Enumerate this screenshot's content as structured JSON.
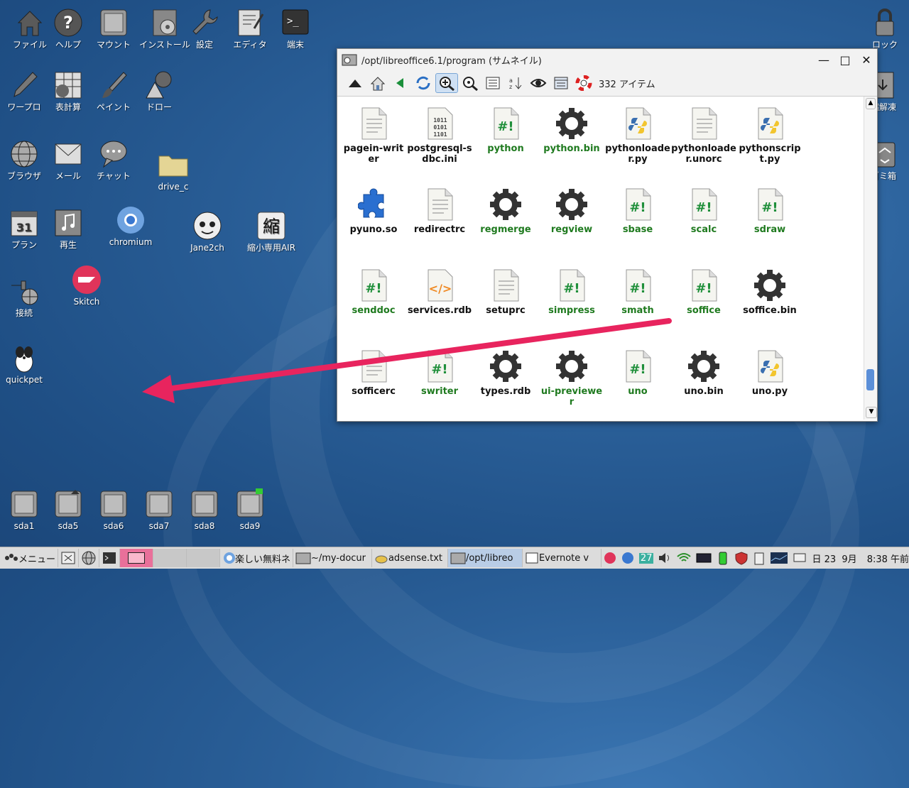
{
  "desktop": {
    "icons": [
      {
        "label": "ファイル"
      },
      {
        "label": "ヘルプ"
      },
      {
        "label": "マウント"
      },
      {
        "label": "インストール"
      },
      {
        "label": "設定"
      },
      {
        "label": "エディタ"
      },
      {
        "label": "端末"
      },
      {
        "label": "ワープロ"
      },
      {
        "label": "表計算"
      },
      {
        "label": "ペイント"
      },
      {
        "label": "ドロー"
      },
      {
        "label": "ブラウザ"
      },
      {
        "label": "メール"
      },
      {
        "label": "チャット"
      },
      {
        "label": "drive_c"
      },
      {
        "label": "プラン"
      },
      {
        "label": "再生"
      },
      {
        "label": "chromium"
      },
      {
        "label": "Jane2ch"
      },
      {
        "label": "縮小専用AIR"
      },
      {
        "label": "接続"
      },
      {
        "label": "Skitch"
      },
      {
        "label": "quickpet"
      },
      {
        "label": "ロック"
      },
      {
        "label": "縮解凍"
      },
      {
        "label": "ゴミ箱"
      }
    ],
    "drives": [
      {
        "label": "sda1"
      },
      {
        "label": "sda5"
      },
      {
        "label": "sda6"
      },
      {
        "label": "sda7"
      },
      {
        "label": "sda8"
      },
      {
        "label": "sda9"
      }
    ]
  },
  "window": {
    "title": "/opt/libreoffice6.1/program (サムネイル)",
    "item_count": "332 アイテム",
    "files": [
      {
        "name": "pagein-writer",
        "type": "text"
      },
      {
        "name": "postgresql-sdbc.ini",
        "type": "binary"
      },
      {
        "name": "python",
        "type": "script"
      },
      {
        "name": "python.bin",
        "type": "exec"
      },
      {
        "name": "pythonloader.py",
        "type": "py"
      },
      {
        "name": "pythonloader.unorc",
        "type": "text"
      },
      {
        "name": "pythonscript.py",
        "type": "py"
      },
      {
        "name": "pyuno.so",
        "type": "plugin"
      },
      {
        "name": "redirectrc",
        "type": "text"
      },
      {
        "name": "regmerge",
        "type": "exec"
      },
      {
        "name": "regview",
        "type": "exec"
      },
      {
        "name": "sbase",
        "type": "script"
      },
      {
        "name": "scalc",
        "type": "script"
      },
      {
        "name": "sdraw",
        "type": "script"
      },
      {
        "name": "senddoc",
        "type": "script"
      },
      {
        "name": "services.rdb",
        "type": "xml"
      },
      {
        "name": "setuprc",
        "type": "text"
      },
      {
        "name": "simpress",
        "type": "script"
      },
      {
        "name": "smath",
        "type": "script"
      },
      {
        "name": "soffice",
        "type": "script"
      },
      {
        "name": "soffice.bin",
        "type": "exec"
      },
      {
        "name": "sofficerc",
        "type": "text"
      },
      {
        "name": "swriter",
        "type": "script"
      },
      {
        "name": "types.rdb",
        "type": "exec"
      },
      {
        "name": "ui-previewer",
        "type": "exec"
      },
      {
        "name": "uno",
        "type": "script"
      },
      {
        "name": "uno.bin",
        "type": "exec"
      },
      {
        "name": "uno.py",
        "type": "py"
      }
    ]
  },
  "taskbar": {
    "menu": "メニュー",
    "tasks": [
      {
        "label": "楽しい無料ネ"
      },
      {
        "label": "~/my-docur"
      },
      {
        "label": "adsense.txt"
      },
      {
        "label": "/opt/libreo"
      },
      {
        "label": "Evernote v"
      }
    ],
    "temp": "27",
    "date": "日 23  9月",
    "time": "8:38 午前"
  },
  "colors": {
    "accent": "#e8245e",
    "green_text": "#1f7a1f"
  }
}
